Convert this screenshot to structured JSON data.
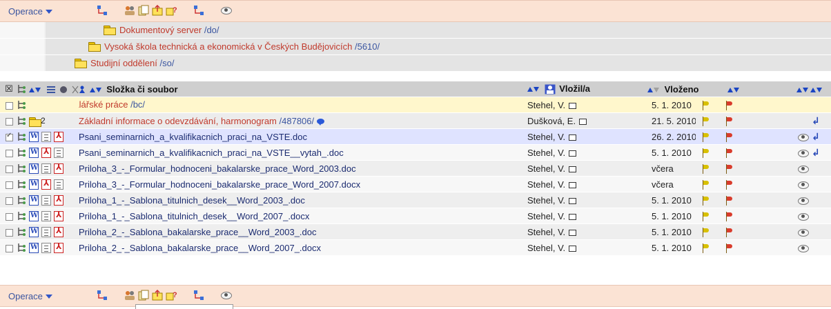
{
  "toolbar": {
    "operations_label": "Operace",
    "icons": [
      "structure-icon",
      "people-icon",
      "document-copy-icon",
      "folder-upload-icon",
      "folder-help-icon",
      "structure-icon",
      "eye-icon"
    ]
  },
  "path": [
    {
      "label": "Dokumentový server",
      "code": "/do/"
    },
    {
      "label": "Vysoká škola technická a ekonomická v Českých Budějovicích",
      "code": "/5610/"
    },
    {
      "label": "Studijní oddělení",
      "code": "/so/"
    }
  ],
  "header": {
    "select_all": "☒",
    "name": "Složka či soubor",
    "author": "Vložil/a",
    "date": "Vloženo"
  },
  "rows": [
    {
      "type": "folder",
      "name": "Bakalářské práce",
      "code": "/bc/",
      "author": "Stehel, V.",
      "date": "5. 1. 2010",
      "checked": false,
      "preview": false,
      "hook": false
    },
    {
      "type": "link",
      "count": "2",
      "name": "Základní informace o odevzdávání, harmonogram",
      "code": "/487806/",
      "author": "Dušková, E.",
      "date": "21. 5. 2010",
      "checked": false,
      "preview": false,
      "hook": true
    },
    {
      "type": "file",
      "icons": [
        "word",
        "doc",
        "pdf"
      ],
      "name": "Psani_seminarnich_a_kvalifikacnich_praci_na_VSTE.doc",
      "author": "Stehel, V.",
      "date": "26. 2. 2010",
      "checked": true,
      "preview": true,
      "hook": true
    },
    {
      "type": "file",
      "icons": [
        "word",
        "pdf",
        "doc"
      ],
      "name": "Psani_seminarnich_a_kvalifikacnich_praci_na_VSTE__vytah_.doc",
      "author": "Stehel, V.",
      "date": "5. 1. 2010",
      "checked": false,
      "preview": true,
      "hook": true
    },
    {
      "type": "file",
      "icons": [
        "word",
        "doc",
        "pdf"
      ],
      "name": "Priloha_3_-_Formular_hodnoceni_bakalarske_prace_Word_2003.doc",
      "author": "Stehel, V.",
      "date": "včera",
      "checked": false,
      "preview": true,
      "hook": false
    },
    {
      "type": "file",
      "icons": [
        "word",
        "pdf",
        "doc"
      ],
      "name": "Priloha_3_-_Formular_hodnoceni_bakalarske_prace_Word_2007.docx",
      "author": "Stehel, V.",
      "date": "včera",
      "checked": false,
      "preview": true,
      "hook": false
    },
    {
      "type": "file",
      "icons": [
        "word",
        "doc",
        "pdf"
      ],
      "name": "Priloha_1_-_Sablona_titulnich_desek__Word_2003_.doc",
      "author": "Stehel, V.",
      "date": "5. 1. 2010",
      "checked": false,
      "preview": true,
      "hook": false
    },
    {
      "type": "file",
      "icons": [
        "word",
        "doc",
        "pdf"
      ],
      "name": "Priloha_1_-_Sablona_titulnich_desek__Word_2007_.docx",
      "author": "Stehel, V.",
      "date": "5. 1. 2010",
      "checked": false,
      "preview": true,
      "hook": false
    },
    {
      "type": "file",
      "icons": [
        "word",
        "doc",
        "pdf"
      ],
      "name": "Priloha_2_-_Sablona_bakalarske_prace__Word_2003_.doc",
      "author": "Stehel, V.",
      "date": "5. 1. 2010",
      "checked": false,
      "preview": true,
      "hook": false
    },
    {
      "type": "file",
      "icons": [
        "word",
        "doc",
        "pdf"
      ],
      "name": "Priloha_2_-_Sablona_bakalarske_prace__Word_2007_.docx",
      "author": "Stehel, V.",
      "date": "5. 1. 2010",
      "checked": false,
      "preview": true,
      "hook": false
    }
  ],
  "footer_toolbar": {
    "operations_label": "Operace"
  }
}
